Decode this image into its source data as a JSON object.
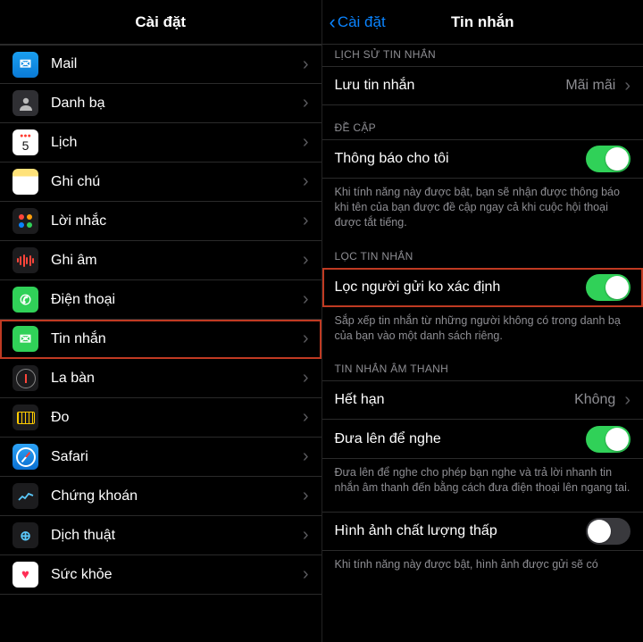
{
  "left": {
    "title": "Cài đặt",
    "items": [
      {
        "label": "Mail",
        "icon": "mail"
      },
      {
        "label": "Danh bạ",
        "icon": "contacts"
      },
      {
        "label": "Lịch",
        "icon": "calendar"
      },
      {
        "label": "Ghi chú",
        "icon": "notes"
      },
      {
        "label": "Lời nhắc",
        "icon": "reminders"
      },
      {
        "label": "Ghi âm",
        "icon": "voice"
      },
      {
        "label": "Điện thoại",
        "icon": "phone"
      },
      {
        "label": "Tin nhắn",
        "icon": "messages",
        "highlight": true
      },
      {
        "label": "La bàn",
        "icon": "compass"
      },
      {
        "label": "Đo",
        "icon": "measure"
      },
      {
        "label": "Safari",
        "icon": "safari"
      },
      {
        "label": "Chứng khoán",
        "icon": "stocks"
      },
      {
        "label": "Dịch thuật",
        "icon": "translate"
      },
      {
        "label": "Sức khỏe",
        "icon": "health"
      }
    ]
  },
  "right": {
    "back": "Cài đặt",
    "title": "Tin nhắn",
    "section_history_cutoff": "LỊCH SỬ TIN NHẮN",
    "keep_messages": {
      "label": "Lưu tin nhắn",
      "value": "Mãi mãi"
    },
    "section_mentions": "ĐỀ CẬP",
    "notify_me": {
      "label": "Thông báo cho tôi",
      "on": true
    },
    "notify_me_footer": "Khi tính năng này được bật, bạn sẽ nhận được thông báo khi tên của bạn được đề cập ngay cả khi cuộc hội thoại được tắt tiếng.",
    "section_filter": "LỌC TIN NHẮN",
    "filter_unknown": {
      "label": "Lọc người gửi ko xác định",
      "on": true
    },
    "filter_unknown_footer": "Sắp xếp tin nhắn từ những người không có trong danh bạ của bạn vào một danh sách riêng.",
    "section_audio": "TIN NHẮN ÂM THANH",
    "expire": {
      "label": "Hết hạn",
      "value": "Không"
    },
    "raise_to_listen": {
      "label": "Đưa lên để nghe",
      "on": true
    },
    "raise_footer": "Đưa lên để nghe cho phép bạn nghe và trả lời nhanh tin nhắn âm thanh đến bằng cách đưa điện thoại lên ngang tai.",
    "low_quality": {
      "label": "Hình ảnh chất lượng thấp",
      "on": false
    },
    "low_quality_footer": "Khi tính năng này được bật, hình ảnh được gửi sẽ có"
  }
}
